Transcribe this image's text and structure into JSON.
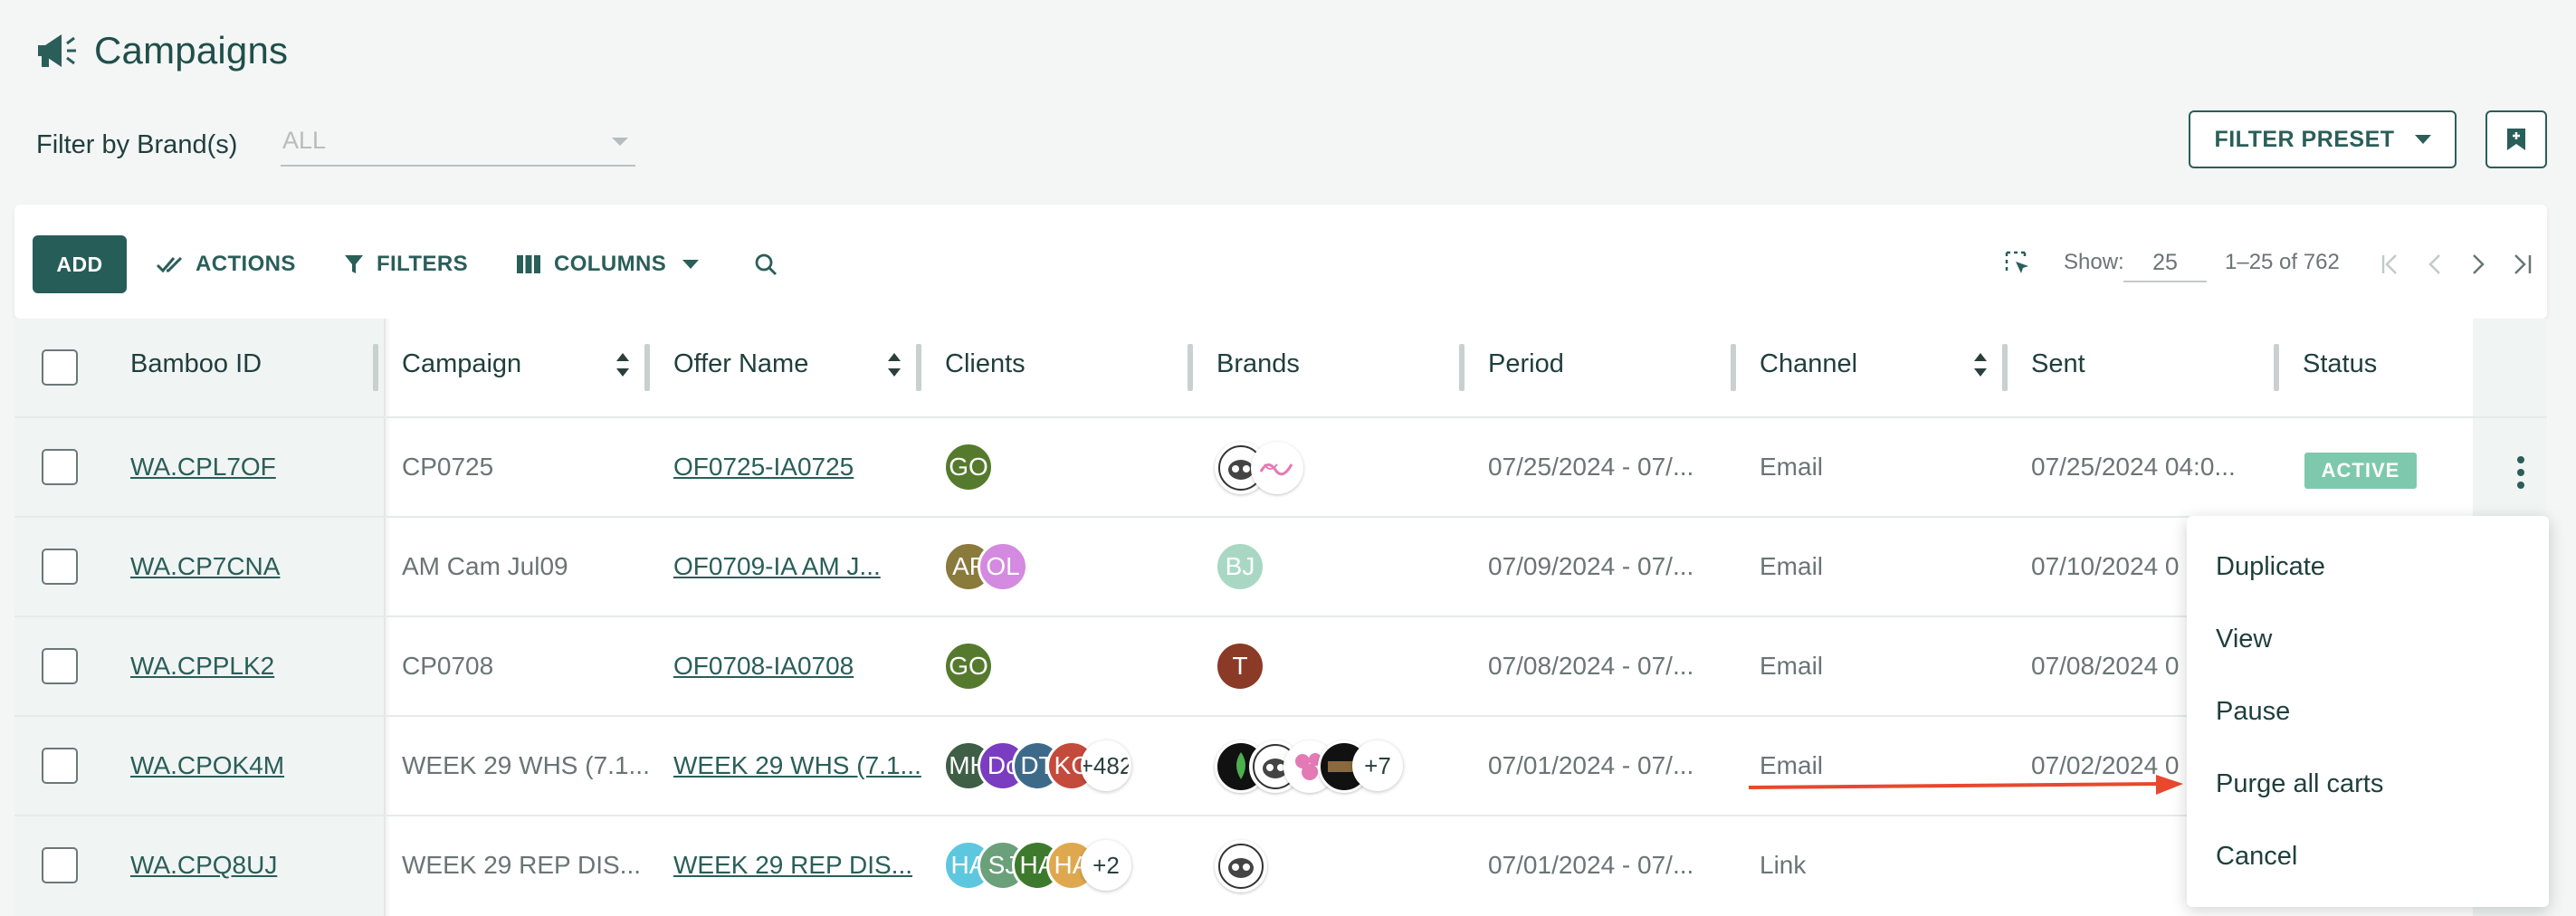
{
  "header": {
    "title": "Campaigns",
    "filter_label": "Filter by Brand(s)",
    "brand_select_value": "ALL",
    "filter_preset_label": "FILTER PRESET"
  },
  "toolbar": {
    "add_label": "ADD",
    "actions_label": "ACTIONS",
    "filters_label": "FILTERS",
    "columns_label": "COLUMNS",
    "show_label": "Show:",
    "page_size": "25",
    "range_text": "1–25 of 762"
  },
  "table": {
    "headers": {
      "bamboo_id": "Bamboo ID",
      "campaign": "Campaign",
      "offer_name": "Offer Name",
      "clients": "Clients",
      "brands": "Brands",
      "period": "Period",
      "channel": "Channel",
      "sent": "Sent",
      "status": "Status"
    },
    "rows": [
      {
        "bamboo_id": "WA.CPL7OF",
        "campaign": "CP0725",
        "offer_name": "OF0725-IA0725",
        "clients": [
          {
            "initials": "GO",
            "color": "#557a2e"
          }
        ],
        "brand_initial": "",
        "period": "07/25/2024 - 07/...",
        "channel": "Email",
        "sent": "07/25/2024 04:0...",
        "status": "ACTIVE"
      },
      {
        "bamboo_id": "WA.CP7CNA",
        "campaign": "AM Cam Jul09",
        "offer_name": "OF0709-IA AM J...",
        "clients": [
          {
            "initials": "AF",
            "color": "#8a7a3c"
          },
          {
            "initials": "OL",
            "color": "#d48ae0"
          }
        ],
        "brand_initial": "BJ",
        "period": "07/09/2024 - 07/...",
        "channel": "Email",
        "sent": "07/10/2024 0",
        "status": ""
      },
      {
        "bamboo_id": "WA.CPPLK2",
        "campaign": "CP0708",
        "offer_name": "OF0708-IA0708",
        "clients": [
          {
            "initials": "GO",
            "color": "#557a2e"
          }
        ],
        "brand_initial": "T",
        "period": "07/08/2024 - 07/...",
        "channel": "Email",
        "sent": "07/08/2024 0",
        "status": ""
      },
      {
        "bamboo_id": "WA.CPOK4M",
        "campaign": "WEEK 29 WHS (7.1...",
        "offer_name": "WEEK 29 WHS (7.1...",
        "clients": [
          {
            "initials": "MH",
            "color": "#3e5e46"
          },
          {
            "initials": "Dc",
            "color": "#7a3cc0"
          },
          {
            "initials": "DT",
            "color": "#3e6a8a"
          },
          {
            "initials": "KC",
            "color": "#c44a3c"
          }
        ],
        "clients_more": "+482",
        "brands_more": "+7",
        "period": "07/01/2024 - 07/...",
        "channel": "Email",
        "sent": "07/02/2024 0",
        "status": ""
      },
      {
        "bamboo_id": "WA.CPQ8UJ",
        "campaign": "WEEK 29 REP DIS...",
        "offer_name": "WEEK 29 REP DIS...",
        "clients": [
          {
            "initials": "HA",
            "color": "#5ec7e0"
          },
          {
            "initials": "SJ",
            "color": "#6aa07a"
          },
          {
            "initials": "HA",
            "color": "#3e7a2e"
          },
          {
            "initials": "HA",
            "color": "#e0a84e"
          }
        ],
        "clients_more": "+2",
        "period": "07/01/2024 - 07/...",
        "channel": "Link",
        "sent": "",
        "status": ""
      }
    ]
  },
  "context_menu": {
    "items": [
      "Duplicate",
      "View",
      "Pause",
      "Purge all carts",
      "Cancel"
    ]
  },
  "colors": {
    "primary": "#275d58",
    "active_badge": "#7ec9ad",
    "arrow": "#e8482e"
  }
}
